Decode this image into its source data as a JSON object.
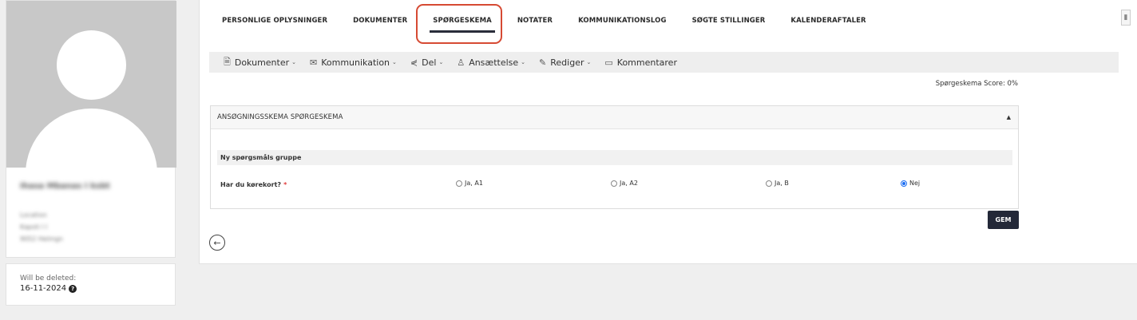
{
  "profile": {
    "name": "Ihasa Mbanas I ksbt",
    "meta": [
      "Location",
      "Kapsti I I",
      "9052 Helmgn"
    ]
  },
  "deletion": {
    "label": "Will be deleted:",
    "date": "16-11-2024",
    "help": "?"
  },
  "tabs": [
    {
      "label": "PERSONLIGE OPLYSNINGER"
    },
    {
      "label": "DOKUMENTER"
    },
    {
      "label": "SPØRGESKEMA",
      "active": true
    },
    {
      "label": "NOTATER"
    },
    {
      "label": "KOMMUNIKATIONSLOG"
    },
    {
      "label": "SØGTE STILLINGER"
    },
    {
      "label": "KALENDERAFTALER"
    }
  ],
  "toolbar": [
    {
      "label": "Dokumenter",
      "icon": "document-icon",
      "glyph": "🗎",
      "caret": true
    },
    {
      "label": "Kommunikation",
      "icon": "envelope-icon",
      "glyph": "✉",
      "caret": true
    },
    {
      "label": "Del",
      "icon": "share-icon",
      "glyph": "⋞",
      "caret": true
    },
    {
      "label": "Ansættelse",
      "icon": "user-check-icon",
      "glyph": "♙",
      "caret": true
    },
    {
      "label": "Rediger",
      "icon": "edit-icon",
      "glyph": "✎",
      "caret": true
    },
    {
      "label": "Kommentarer",
      "icon": "comment-icon",
      "glyph": "▭",
      "caret": false
    }
  ],
  "score_text": "Spørgeskema Score: 0%",
  "panel": {
    "title": "ANSØGNINGSSKEMA SPØRGESKEMA",
    "collapse_glyph": "▲",
    "group_title": "Ny spørgsmåls gruppe",
    "question": "Har du kørekort?",
    "required_mark": "*",
    "options": [
      {
        "label": "Ja, A1",
        "checked": false
      },
      {
        "label": "Ja, A2",
        "checked": false
      },
      {
        "label": "Ja, B",
        "checked": false
      },
      {
        "label": "Nej",
        "checked": true
      }
    ]
  },
  "save_label": "GEM",
  "back_glyph": "←",
  "accent_colors": {
    "highlight": "#d64a33",
    "button": "#232838",
    "radio": "#1c6ef2"
  }
}
